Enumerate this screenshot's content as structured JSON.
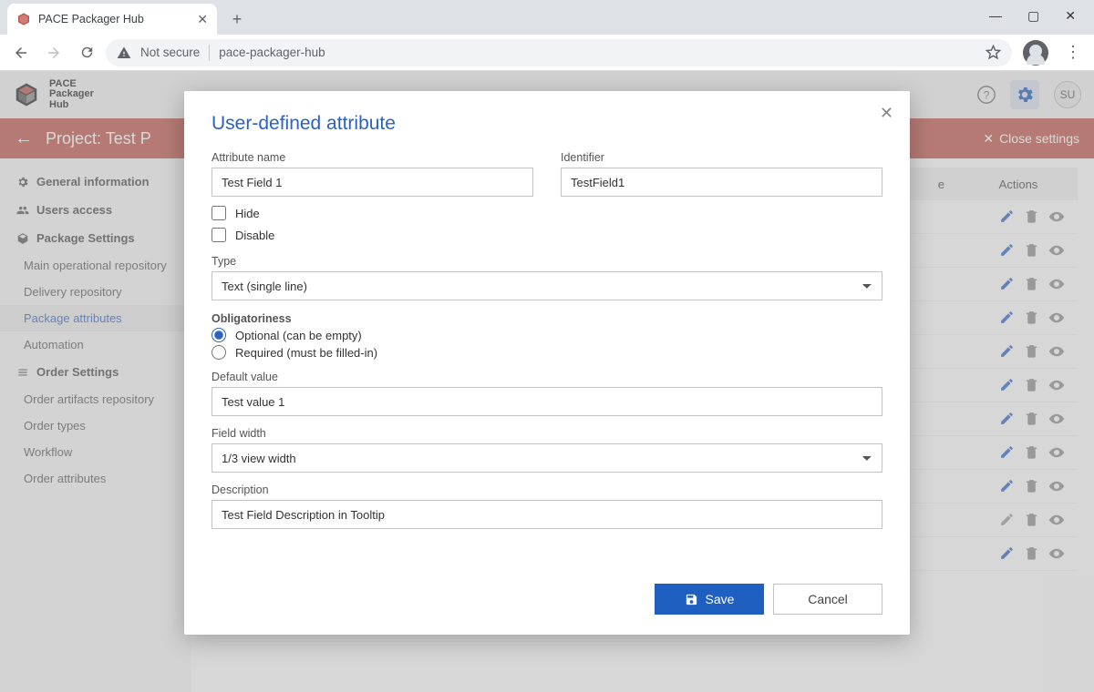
{
  "browser": {
    "tab_title": "PACE Packager Hub",
    "security_label": "Not secure",
    "url": "pace-packager-hub"
  },
  "app": {
    "logo_line1": "PACE",
    "logo_line2": "Packager",
    "logo_line3": "Hub",
    "user_initials": "SU"
  },
  "banner": {
    "title": "Project: Test P",
    "close_label": "Close settings"
  },
  "sidebar": {
    "sections": [
      {
        "label": "General information",
        "icon": "gear-icon"
      },
      {
        "label": "Users access",
        "icon": "users-icon"
      },
      {
        "label": "Package Settings",
        "icon": "package-icon",
        "items": [
          {
            "label": "Main operational repository"
          },
          {
            "label": "Delivery repository"
          },
          {
            "label": "Package attributes",
            "active": true
          },
          {
            "label": "Automation"
          }
        ]
      },
      {
        "label": "Order Settings",
        "icon": "list-icon",
        "items": [
          {
            "label": "Order artifacts repository"
          },
          {
            "label": "Order types"
          },
          {
            "label": "Workflow"
          },
          {
            "label": "Order attributes"
          }
        ]
      }
    ]
  },
  "table": {
    "col_hide": "e",
    "col_actions": "Actions",
    "rows_count": 11,
    "muted_row_index": 9
  },
  "modal": {
    "title": "User-defined attribute",
    "labels": {
      "attribute_name": "Attribute name",
      "identifier": "Identifier",
      "hide": "Hide",
      "disable": "Disable",
      "type": "Type",
      "obligatoriness": "Obligatoriness",
      "optional": "Optional (can be empty)",
      "required": "Required (must be filled-in)",
      "default_value": "Default value",
      "field_width": "Field width",
      "description": "Description"
    },
    "values": {
      "attribute_name": "Test Field 1",
      "identifier": "TestField1",
      "hide_checked": false,
      "disable_checked": false,
      "type": "Text (single line)",
      "obligatoriness": "optional",
      "default_value": "Test value 1",
      "field_width": "1/3 view width",
      "description": "Test Field Description in Tooltip"
    },
    "buttons": {
      "save": "Save",
      "cancel": "Cancel"
    }
  }
}
